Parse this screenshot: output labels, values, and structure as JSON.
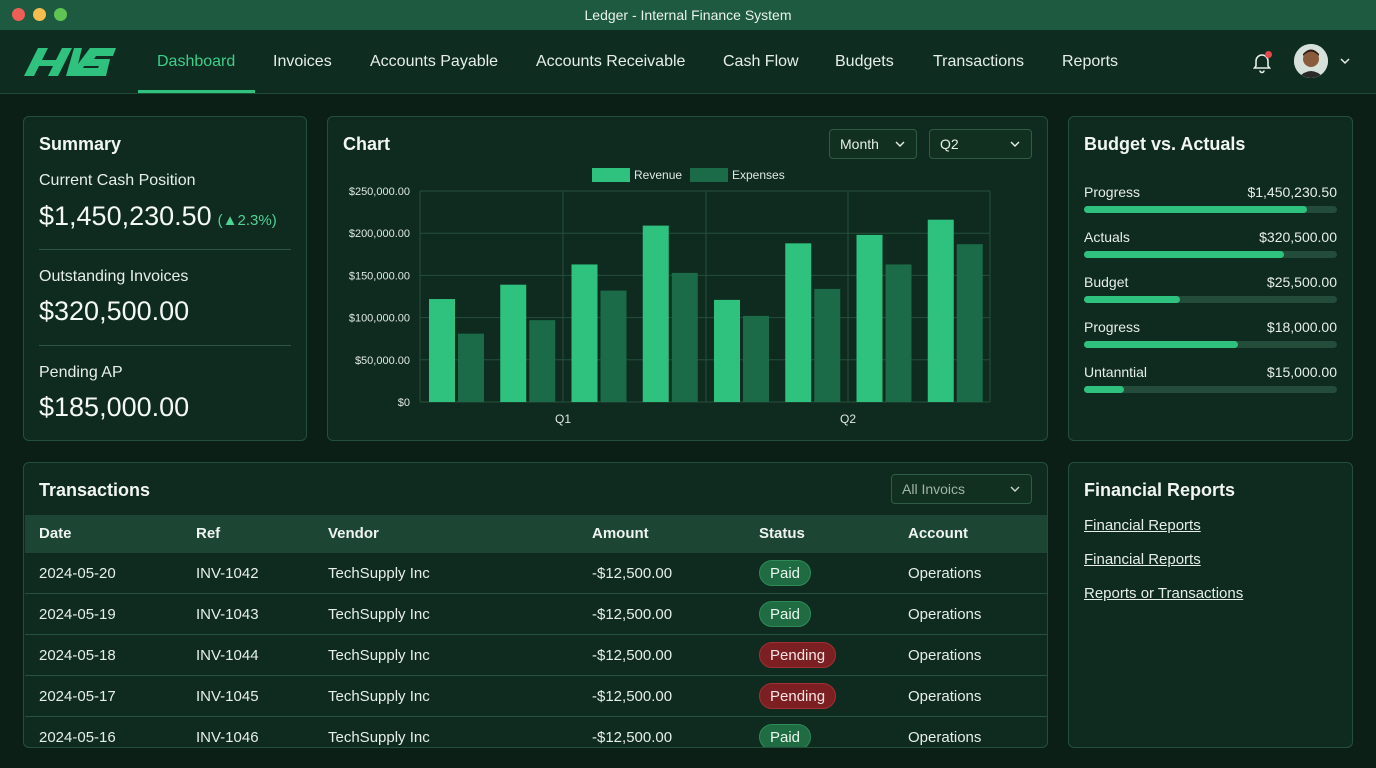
{
  "window": {
    "title": "Ledger - Internal Finance System"
  },
  "nav": {
    "logo_text": "AVS",
    "items": [
      {
        "label": "Dashboard",
        "active": true
      },
      {
        "label": "Invoices"
      },
      {
        "label": "Accounts Payable"
      },
      {
        "label": "Accounts Receivable"
      },
      {
        "label": "Cash Flow"
      },
      {
        "label": "Budgets"
      },
      {
        "label": "Transactions"
      },
      {
        "label": "Reports"
      }
    ],
    "icons": [
      "bell-icon",
      "avatar",
      "chevron-down-icon"
    ]
  },
  "summary": {
    "title": "Summary",
    "cash_label": "Current Cash Position",
    "cash_value": "$1,450,230.50",
    "cash_change": "(▲2.3%)",
    "invoices_label": "Outstanding Invoices",
    "invoices_value": "$320,500.00",
    "ap_label": "Pending AP",
    "ap_value": "$185,000.00"
  },
  "chart": {
    "title": "Chart",
    "period_select": "Month",
    "quarter_select": "Q2"
  },
  "chart_data": {
    "type": "bar",
    "title": "",
    "xlabel": "",
    "ylabel": "",
    "ylim": [
      0,
      250000
    ],
    "yticks": [
      "$0",
      "$50,000.00",
      "$100,000.00",
      "$150,000.00",
      "$200,000.00",
      "$250,000.00"
    ],
    "xticks": [
      "Q1",
      "Q2"
    ],
    "legend": "top-center",
    "grid": true,
    "categories": [
      "1",
      "2",
      "3",
      "4",
      "5",
      "6",
      "7",
      "8"
    ],
    "series": [
      {
        "name": "Revenue",
        "color": "#2ec27e",
        "values": [
          122000,
          139000,
          163000,
          209000,
          121000,
          188000,
          198000,
          216000
        ]
      },
      {
        "name": "Expenses",
        "color": "#1b6a48",
        "values": [
          81000,
          97000,
          132000,
          153000,
          102000,
          134000,
          163000,
          187000
        ]
      }
    ]
  },
  "budget": {
    "title": "Budget vs. Actuals",
    "rows": [
      {
        "label": "Progress",
        "value": "$1,450,230.50",
        "fill": 0.88
      },
      {
        "label": "Actuals",
        "value": "$320,500.00",
        "fill": 0.79
      },
      {
        "label": "Budget",
        "value": "$25,500.00",
        "fill": 0.38
      },
      {
        "label": "Progress",
        "value": "$18,000.00",
        "fill": 0.61
      },
      {
        "label": "Untanntial",
        "value": "$15,000.00",
        "fill": 0.16
      }
    ]
  },
  "transactions": {
    "title": "Transactions",
    "filter": "All Invoics",
    "columns": [
      "Date",
      "Ref",
      "Vendor",
      "Amount",
      "Status",
      "Account"
    ],
    "rows": [
      {
        "date": "2024-05-20",
        "ref": "INV-1042",
        "vendor": "TechSupply Inc",
        "amount": "-$12,500.00",
        "status": "Paid",
        "account": "Operations"
      },
      {
        "date": "2024-05-19",
        "ref": "INV-1043",
        "vendor": "TechSupply Inc",
        "amount": "-$12,500.00",
        "status": "Paid",
        "account": "Operations"
      },
      {
        "date": "2024-05-18",
        "ref": "INV-1044",
        "vendor": "TechSupply Inc",
        "amount": "-$12,500.00",
        "status": "Pending",
        "account": "Operations"
      },
      {
        "date": "2024-05-17",
        "ref": "INV-1045",
        "vendor": "TechSupply Inc",
        "amount": "-$12,500.00",
        "status": "Pending",
        "account": "Operations"
      },
      {
        "date": "2024-05-16",
        "ref": "INV-1046",
        "vendor": "TechSupply Inc",
        "amount": "-$12,500.00",
        "status": "Paid",
        "account": "Operations"
      }
    ]
  },
  "reports": {
    "title": "Financial Reports",
    "links": [
      "Financial Reports",
      "Financial Reports",
      "Reports or Transactions"
    ]
  },
  "colors": {
    "accent": "#2ec27e",
    "paid": "#1f6b42",
    "pending": "#7c1f22",
    "background": "#0b1f17"
  }
}
